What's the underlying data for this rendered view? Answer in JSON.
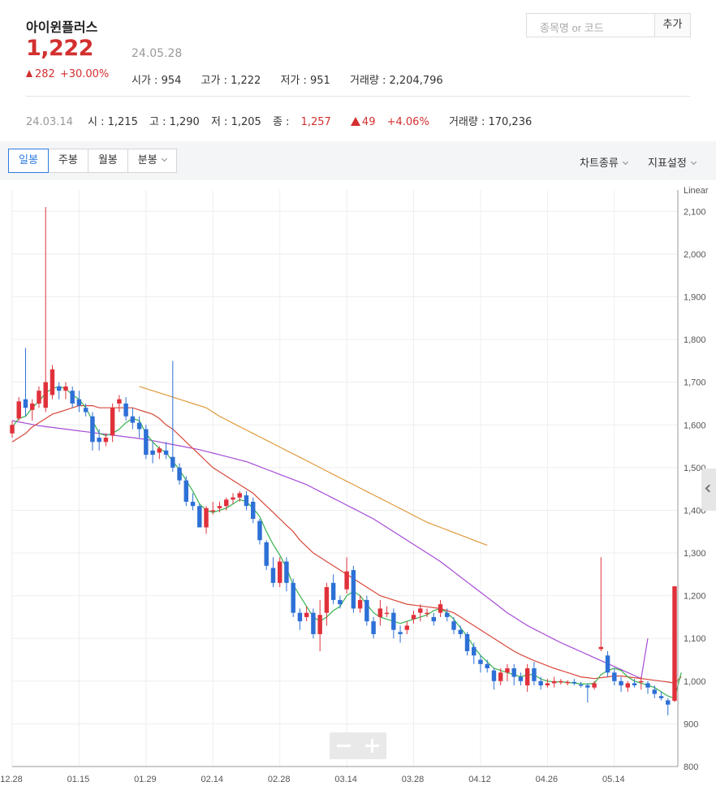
{
  "header": {
    "name": "아이윈플러스",
    "price": "1,222",
    "change": "282",
    "change_pct": "+30.00%",
    "date": "24.05.28",
    "stats": [
      "시가 : 954",
      "고가 : 1,222",
      "저가 : 951",
      "거래량 : 2,204,796"
    ]
  },
  "search": {
    "placeholder": "종목명 or 코드",
    "add_label": "추가"
  },
  "daybar": {
    "date": "24.03.14",
    "open": "시 : 1,215",
    "high": "고 : 1,290",
    "low": "저 : 1,205",
    "close_label": "종 :",
    "close": "1,257",
    "change": "49",
    "change_pct": "+4.06%",
    "volume": "거래량 : 170,236"
  },
  "toolbar": {
    "tabs": [
      "일봉",
      "주봉",
      "월봉",
      "분봉"
    ],
    "chart_type": "차트종류",
    "indicator": "지표설정"
  },
  "colors": {
    "up": "#e0313b",
    "down": "#2d70d6",
    "ma5": "#37b24d",
    "ma20": "#d9483b",
    "ma60": "#a64bd6",
    "ma120": "#e0993b"
  },
  "chart_data": {
    "type": "candlestick",
    "scale_label": "Linear",
    "ylim": [
      800,
      2150
    ],
    "y_ticks": [
      800,
      900,
      1000,
      1100,
      1200,
      1300,
      1400,
      1500,
      1600,
      1700,
      1800,
      1900,
      2000,
      2100
    ],
    "x_ticks": [
      "12.28",
      "01.15",
      "01.29",
      "02.14",
      "02.28",
      "03.14",
      "03.28",
      "04.12",
      "04.26",
      "05.14"
    ],
    "x_tick_index": [
      0,
      10,
      20,
      30,
      40,
      50,
      60,
      70,
      80,
      90
    ],
    "candles": [
      [
        1580,
        1610,
        1570,
        1600
      ],
      [
        1615,
        1665,
        1610,
        1655
      ],
      [
        1660,
        1780,
        1620,
        1640
      ],
      [
        1635,
        1660,
        1610,
        1650
      ],
      [
        1650,
        1690,
        1640,
        1680
      ],
      [
        1640,
        2110,
        1630,
        1700
      ],
      [
        1670,
        1740,
        1660,
        1730
      ],
      [
        1690,
        1700,
        1660,
        1680
      ],
      [
        1680,
        1700,
        1660,
        1690
      ],
      [
        1680,
        1690,
        1640,
        1650
      ],
      [
        1660,
        1680,
        1630,
        1645
      ],
      [
        1640,
        1650,
        1620,
        1630
      ],
      [
        1620,
        1630,
        1540,
        1560
      ],
      [
        1570,
        1590,
        1540,
        1560
      ],
      [
        1560,
        1580,
        1550,
        1570
      ],
      [
        1575,
        1650,
        1560,
        1640
      ],
      [
        1650,
        1670,
        1630,
        1660
      ],
      [
        1650,
        1665,
        1610,
        1620
      ],
      [
        1620,
        1640,
        1590,
        1605
      ],
      [
        1605,
        1620,
        1570,
        1590
      ],
      [
        1590,
        1600,
        1520,
        1530
      ],
      [
        1540,
        1560,
        1510,
        1530
      ],
      [
        1535,
        1550,
        1520,
        1545
      ],
      [
        1540,
        1560,
        1520,
        1530
      ],
      [
        1525,
        1750,
        1490,
        1500
      ],
      [
        1500,
        1510,
        1460,
        1470
      ],
      [
        1470,
        1480,
        1410,
        1420
      ],
      [
        1420,
        1440,
        1400,
        1410
      ],
      [
        1410,
        1415,
        1370,
        1360
      ],
      [
        1360,
        1410,
        1345,
        1405
      ],
      [
        1400,
        1420,
        1390,
        1400
      ],
      [
        1405,
        1420,
        1395,
        1410
      ],
      [
        1410,
        1430,
        1400,
        1425
      ],
      [
        1425,
        1440,
        1415,
        1430
      ],
      [
        1430,
        1445,
        1420,
        1440
      ],
      [
        1435,
        1445,
        1400,
        1410
      ],
      [
        1420,
        1430,
        1370,
        1380
      ],
      [
        1375,
        1380,
        1320,
        1330
      ],
      [
        1325,
        1330,
        1260,
        1270
      ],
      [
        1265,
        1290,
        1220,
        1230
      ],
      [
        1230,
        1290,
        1220,
        1280
      ],
      [
        1280,
        1290,
        1210,
        1230
      ],
      [
        1230,
        1240,
        1150,
        1160
      ],
      [
        1160,
        1170,
        1120,
        1140
      ],
      [
        1150,
        1175,
        1140,
        1160
      ],
      [
        1160,
        1170,
        1100,
        1110
      ],
      [
        1110,
        1190,
        1070,
        1155
      ],
      [
        1160,
        1230,
        1130,
        1220
      ],
      [
        1230,
        1250,
        1180,
        1190
      ],
      [
        1190,
        1200,
        1170,
        1180
      ],
      [
        1215,
        1290,
        1205,
        1257
      ],
      [
        1260,
        1270,
        1160,
        1170
      ],
      [
        1170,
        1200,
        1160,
        1190
      ],
      [
        1190,
        1200,
        1130,
        1140
      ],
      [
        1140,
        1150,
        1100,
        1110
      ],
      [
        1150,
        1190,
        1130,
        1170
      ],
      [
        1160,
        1175,
        1150,
        1160
      ],
      [
        1160,
        1170,
        1100,
        1120
      ],
      [
        1115,
        1130,
        1090,
        1110
      ],
      [
        1120,
        1140,
        1110,
        1130
      ],
      [
        1145,
        1165,
        1135,
        1155
      ],
      [
        1160,
        1180,
        1140,
        1170
      ],
      [
        1160,
        1170,
        1150,
        1160
      ],
      [
        1150,
        1160,
        1130,
        1140
      ],
      [
        1160,
        1190,
        1150,
        1180
      ],
      [
        1160,
        1170,
        1140,
        1150
      ],
      [
        1140,
        1150,
        1110,
        1120
      ],
      [
        1120,
        1130,
        1100,
        1110
      ],
      [
        1110,
        1115,
        1060,
        1070
      ],
      [
        1080,
        1090,
        1040,
        1060
      ],
      [
        1050,
        1060,
        1020,
        1040
      ],
      [
        1040,
        1050,
        1020,
        1030
      ],
      [
        1025,
        1030,
        980,
        1000
      ],
      [
        1000,
        1030,
        990,
        1020
      ],
      [
        1020,
        1040,
        1000,
        1030
      ],
      [
        1030,
        1040,
        990,
        1010
      ],
      [
        1010,
        1020,
        990,
        1000
      ],
      [
        990,
        1040,
        975,
        1030
      ],
      [
        1030,
        1045,
        990,
        1000
      ],
      [
        1000,
        1010,
        980,
        990
      ],
      [
        990,
        1005,
        985,
        995
      ],
      [
        995,
        1010,
        985,
        1000
      ],
      [
        998,
        1005,
        992,
        1000
      ],
      [
        996,
        1002,
        990,
        998
      ],
      [
        998,
        1005,
        990,
        995
      ],
      [
        992,
        998,
        985,
        990
      ],
      [
        990,
        995,
        950,
        985
      ],
      [
        985,
        1000,
        980,
        995
      ],
      [
        1075,
        1290,
        1070,
        1080
      ],
      [
        1060,
        1070,
        1010,
        1020
      ],
      [
        1020,
        1030,
        990,
        1000
      ],
      [
        1000,
        1010,
        975,
        990
      ],
      [
        985,
        1000,
        975,
        995
      ],
      [
        995,
        1005,
        985,
        990
      ],
      [
        1000,
        1010,
        980,
        1000
      ],
      [
        995,
        1000,
        970,
        985
      ],
      [
        980,
        990,
        960,
        970
      ],
      [
        965,
        975,
        955,
        960
      ],
      [
        955,
        960,
        920,
        945
      ],
      [
        954,
        1222,
        951,
        1222
      ]
    ],
    "ma5": [
      1595,
      1615,
      1620,
      1640,
      1655,
      1675,
      1685,
      1690,
      1685,
      1670,
      1660,
      1640,
      1610,
      1580,
      1575,
      1580,
      1590,
      1605,
      1615,
      1610,
      1580,
      1560,
      1545,
      1535,
      1515,
      1495,
      1470,
      1445,
      1415,
      1400,
      1395,
      1400,
      1405,
      1415,
      1425,
      1420,
      1405,
      1385,
      1350,
      1320,
      1295,
      1265,
      1225,
      1200,
      1175,
      1150,
      1140,
      1150,
      1165,
      1175,
      1200,
      1210,
      1200,
      1180,
      1160,
      1150,
      1145,
      1140,
      1135,
      1140,
      1145,
      1150,
      1155,
      1165,
      1170,
      1160,
      1145,
      1125,
      1105,
      1080,
      1060,
      1045,
      1030,
      1025,
      1020,
      1015,
      1010,
      1015,
      1015,
      1005,
      1000,
      998,
      998,
      997,
      995,
      994,
      993,
      995,
      1015,
      1025,
      1030,
      1025,
      1010,
      1000,
      995,
      990,
      985,
      975,
      965,
      960,
      1020
    ],
    "ma20": [
      1560,
      1570,
      1580,
      1595,
      1605,
      1615,
      1625,
      1630,
      1635,
      1640,
      1645,
      1645,
      1645,
      1640,
      1640,
      1640,
      1640,
      1640,
      1640,
      1635,
      1630,
      1625,
      1615,
      1600,
      1590,
      1575,
      1560,
      1545,
      1530,
      1515,
      1500,
      1490,
      1480,
      1470,
      1460,
      1450,
      1440,
      1425,
      1410,
      1395,
      1380,
      1365,
      1350,
      1330,
      1315,
      1300,
      1290,
      1280,
      1270,
      1260,
      1250,
      1240,
      1230,
      1220,
      1210,
      1200,
      1195,
      1190,
      1185,
      1180,
      1178,
      1176,
      1174,
      1172,
      1170,
      1165,
      1160,
      1150,
      1140,
      1130,
      1120,
      1110,
      1100,
      1090,
      1080,
      1070,
      1062,
      1055,
      1048,
      1042,
      1036,
      1030,
      1025,
      1020,
      1015,
      1010,
      1008,
      1006,
      1008,
      1010,
      1012,
      1012,
      1010,
      1008,
      1006,
      1004,
      1002,
      1000,
      998,
      995,
      1010
    ],
    "ma60": [
      1610,
      1607,
      1604,
      1601,
      1598,
      1596,
      1594,
      1592,
      1590,
      1588,
      1586,
      1584,
      1582,
      1580,
      1578,
      1576,
      1574,
      1572,
      1570,
      1568,
      1566,
      1563,
      1560,
      1557,
      1554,
      1551,
      1548,
      1545,
      1542,
      1538,
      1534,
      1530,
      1526,
      1522,
      1518,
      1514,
      1508,
      1502,
      1496,
      1490,
      1484,
      1478,
      1472,
      1466,
      1460,
      1452,
      1444,
      1436,
      1428,
      1420,
      1412,
      1404,
      1396,
      1388,
      1380,
      1370,
      1360,
      1350,
      1340,
      1330,
      1320,
      1310,
      1300,
      1290,
      1280,
      1268,
      1256,
      1244,
      1232,
      1220,
      1208,
      1196,
      1184,
      1172,
      1160,
      1150,
      1140,
      1130,
      1122,
      1114,
      1106,
      1098,
      1090,
      1083,
      1076,
      1069,
      1062,
      1055,
      1048,
      1041,
      1034,
      1027,
      1020,
      1013,
      1006,
      1100
    ],
    "ma120_start": 19,
    "ma120": [
      1690,
      1685,
      1680,
      1675,
      1670,
      1665,
      1660,
      1655,
      1650,
      1645,
      1640,
      1630,
      1620,
      1612,
      1604,
      1596,
      1588,
      1580,
      1572,
      1564,
      1556,
      1548,
      1540,
      1532,
      1524,
      1516,
      1508,
      1500,
      1492,
      1484,
      1476,
      1468,
      1460,
      1452,
      1444,
      1436,
      1428,
      1420,
      1412,
      1404,
      1396,
      1388,
      1380,
      1372,
      1366,
      1360,
      1354,
      1348,
      1342,
      1336,
      1330,
      1324,
      1318
    ]
  }
}
